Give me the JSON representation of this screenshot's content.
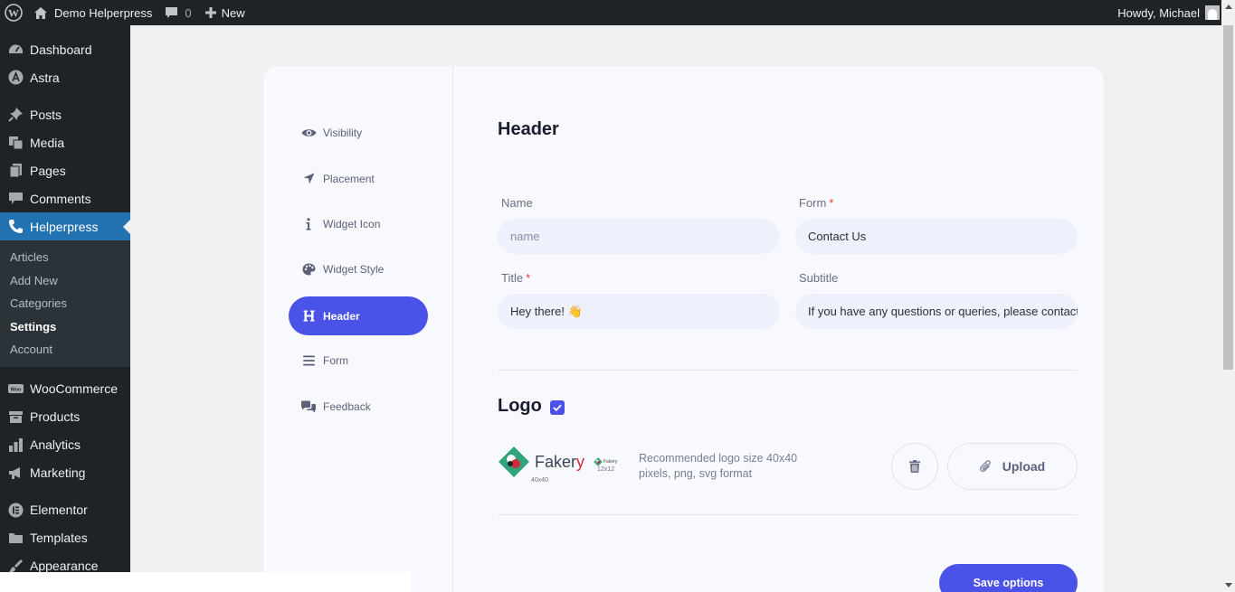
{
  "adminbar": {
    "site_name": "Demo Helperpress",
    "comments_count": "0",
    "new_label": "New",
    "greeting": "Howdy, Michael"
  },
  "sidebar": {
    "items": [
      {
        "label": "Dashboard",
        "icon": "dashboard-icon"
      },
      {
        "label": "Astra",
        "icon": "astra-icon"
      },
      {
        "label": "Posts",
        "icon": "pin-icon"
      },
      {
        "label": "Media",
        "icon": "media-icon"
      },
      {
        "label": "Pages",
        "icon": "pages-icon"
      },
      {
        "label": "Comments",
        "icon": "comments-icon"
      },
      {
        "label": "Helperpress",
        "icon": "phone-icon"
      },
      {
        "label": "WooCommerce",
        "icon": "woo-icon"
      },
      {
        "label": "Products",
        "icon": "archive-icon"
      },
      {
        "label": "Analytics",
        "icon": "bar-chart-icon"
      },
      {
        "label": "Marketing",
        "icon": "megaphone-icon"
      },
      {
        "label": "Elementor",
        "icon": "elementor-icon"
      },
      {
        "label": "Templates",
        "icon": "folder-icon"
      },
      {
        "label": "Appearance",
        "icon": "brush-icon"
      }
    ],
    "submenu": [
      "Articles",
      "Add New",
      "Categories",
      "Settings",
      "Account"
    ]
  },
  "settings_nav": [
    {
      "label": "Visibility",
      "icon": "eye-icon"
    },
    {
      "label": "Placement",
      "icon": "location-arrow-icon"
    },
    {
      "label": "Widget Icon",
      "icon": "info-icon"
    },
    {
      "label": "Widget Style",
      "icon": "palette-icon"
    },
    {
      "label": "Header",
      "icon": "heading-icon"
    },
    {
      "label": "Form",
      "icon": "bars-icon"
    },
    {
      "label": "Feedback",
      "icon": "chat-bubbles-icon"
    }
  ],
  "header_section": {
    "title": "Header",
    "name_label": "Name",
    "name_placeholder": "name",
    "form_label": "Form",
    "form_value": "Contact Us",
    "title_label": "Title",
    "title_value": "Hey there! 👋",
    "subtitle_label": "Subtitle",
    "subtitle_value": "If you have any questions or queries, please contact us",
    "required_mark": "*"
  },
  "logo_section": {
    "title": "Logo",
    "enabled": true,
    "logo_name_main": "Faker",
    "logo_name_tail": "y",
    "logo_small_text": "Fakery",
    "size_large_caption": "40x40",
    "size_small_caption": "12x12",
    "description": "Recommended logo size 40x40 pixels, png, svg format",
    "upload_label": "Upload"
  },
  "save_label": "Save options",
  "colors": {
    "accent": "#4b52e8",
    "admin_bar": "#1d2327",
    "sidebar_current": "#2271b1",
    "required": "#e53d3d"
  }
}
